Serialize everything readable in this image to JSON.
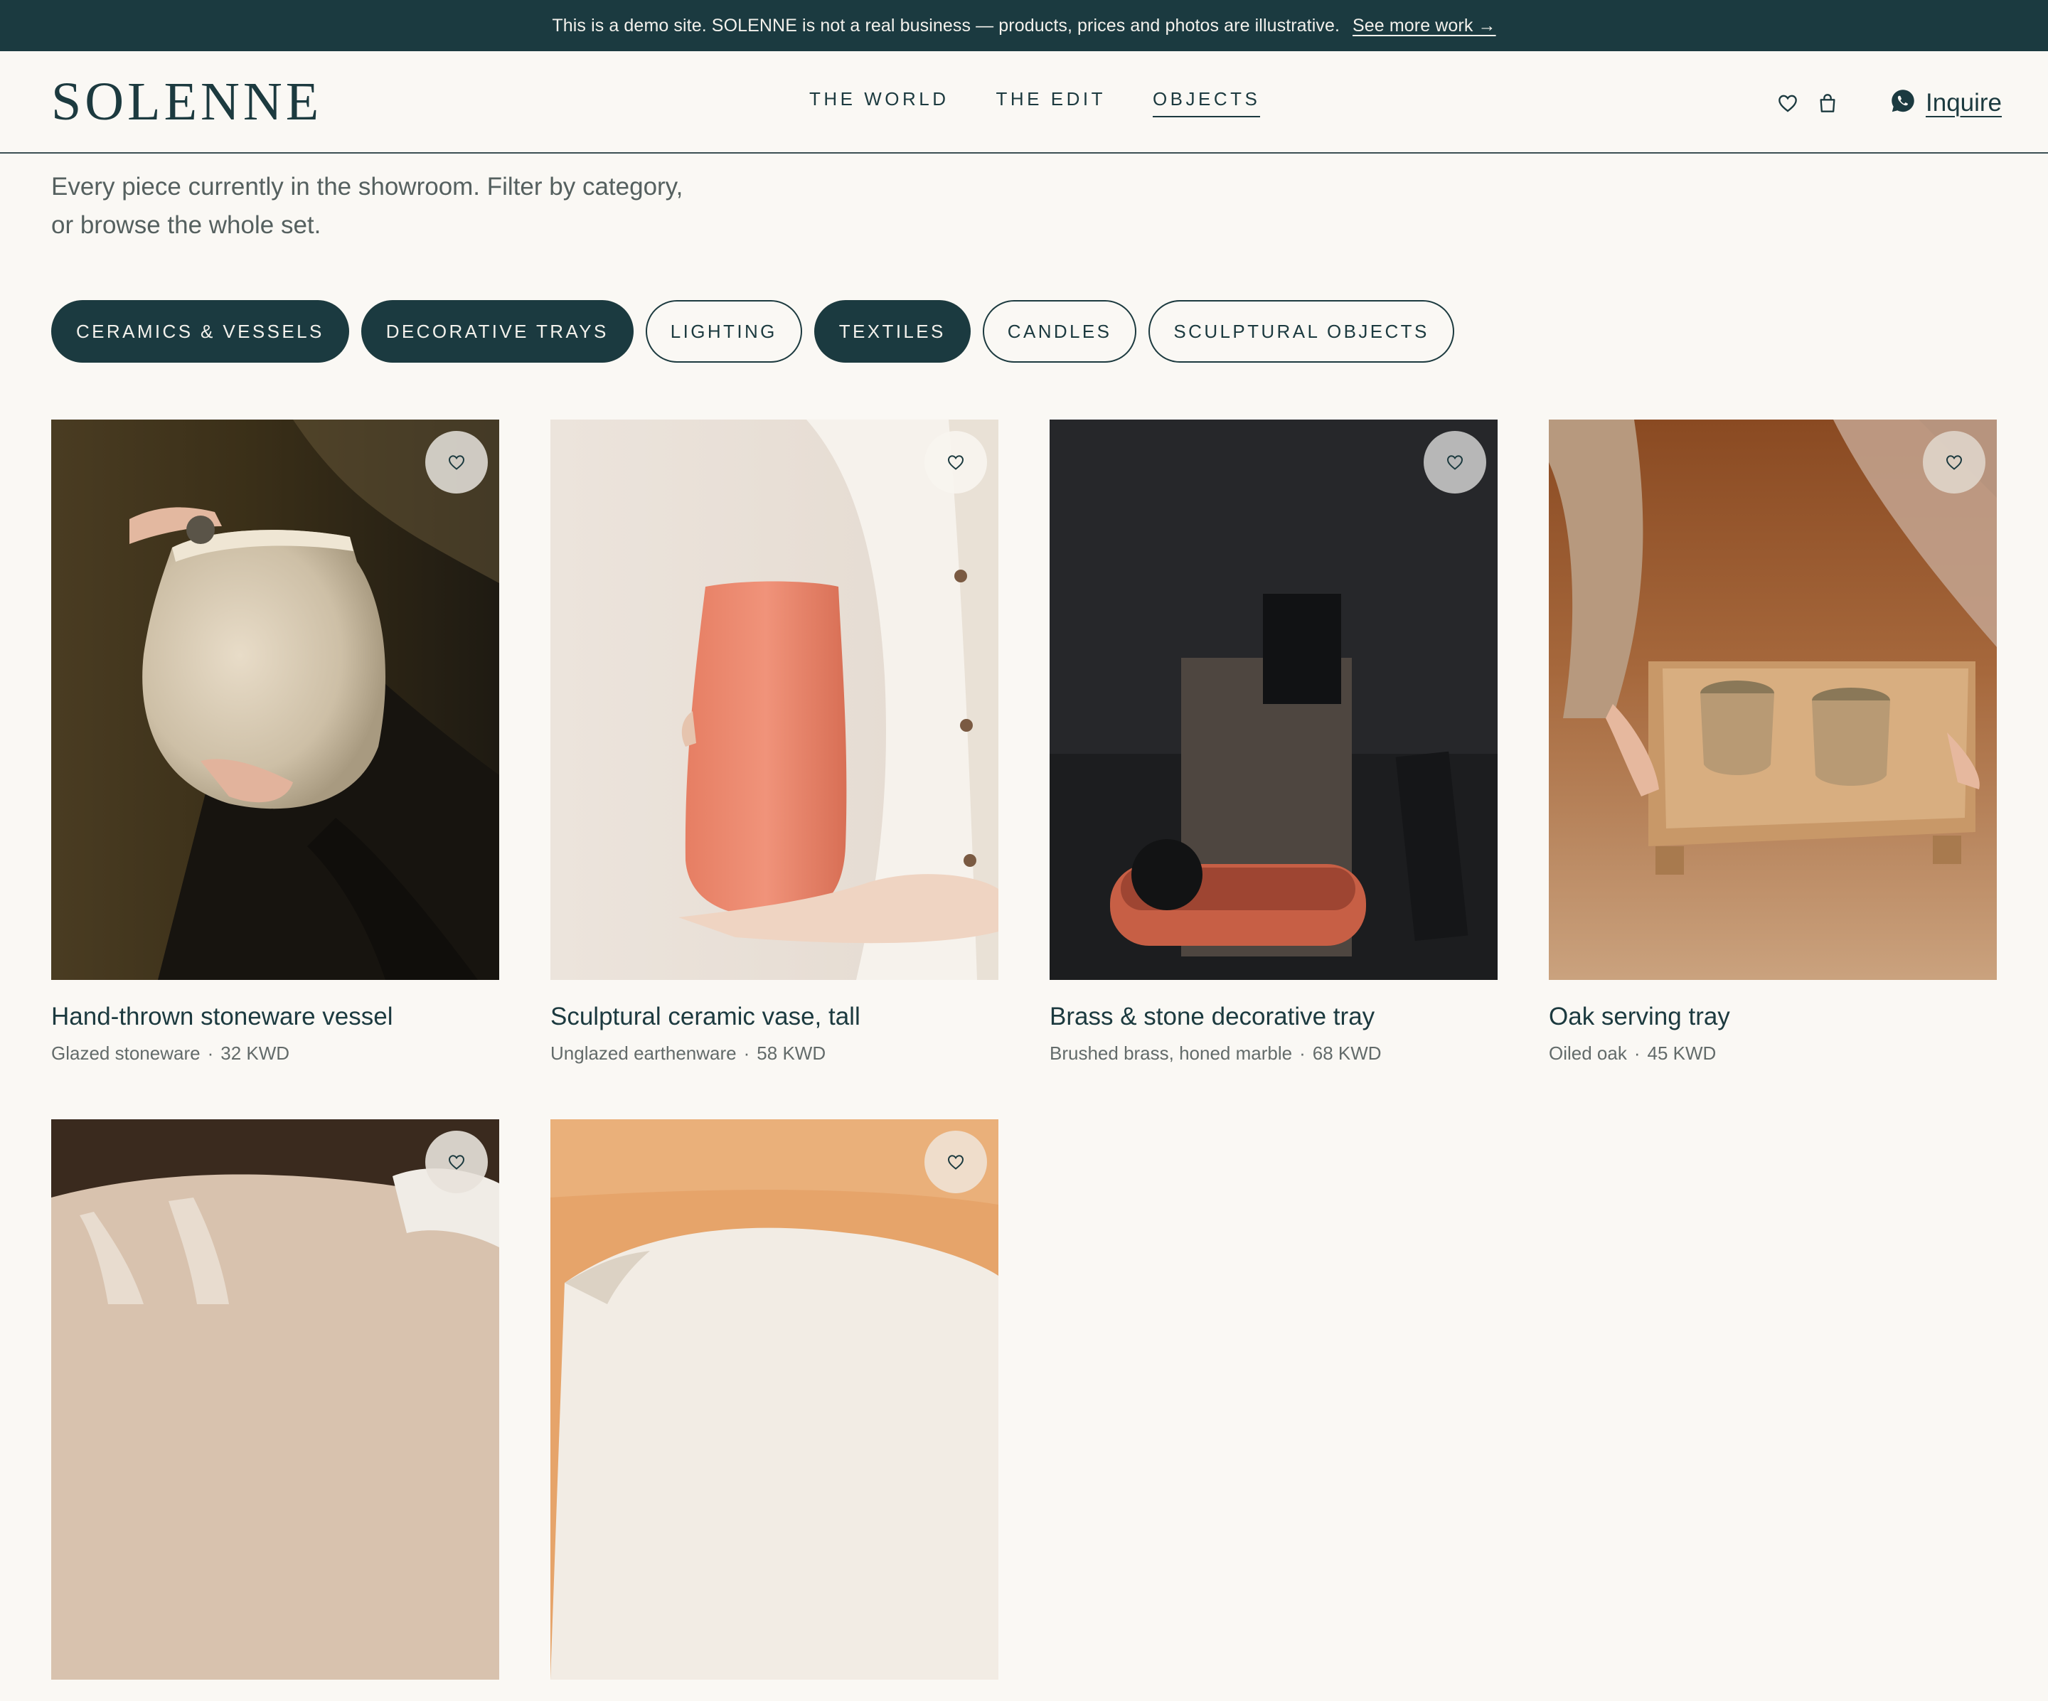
{
  "banner": {
    "text": "This is a demo site. SOLENNE is not a real business — products, prices and photos are illustrative.",
    "link": "See more work →"
  },
  "header": {
    "logo": "SOLENNE",
    "nav": [
      "THE WORLD",
      "THE EDIT",
      "OBJECTS"
    ],
    "active_nav": "OBJECTS",
    "icons": [
      "heart-icon",
      "bag-icon"
    ],
    "inquire_icon": "whatsapp-icon",
    "inquire_label": "Inquire"
  },
  "intro": {
    "line1": "Every piece currently in the showroom. Filter by category,",
    "line2": "or browse the whole set."
  },
  "filters": [
    {
      "label": "CERAMICS & VESSELS",
      "active": true
    },
    {
      "label": "DECORATIVE TRAYS",
      "active": true
    },
    {
      "label": "LIGHTING",
      "active": false
    },
    {
      "label": "TEXTILES",
      "active": true
    },
    {
      "label": "CANDLES",
      "active": false
    },
    {
      "label": "SCULPTURAL OBJECTS",
      "active": false
    }
  ],
  "products": [
    {
      "title": "Hand-thrown stoneware vessel",
      "material": "Glazed stoneware",
      "price": "32 KWD"
    },
    {
      "title": "Sculptural ceramic vase, tall",
      "material": "Unglazed earthenware",
      "price": "58 KWD"
    },
    {
      "title": "Brass & stone decorative tray",
      "material": "Brushed brass, honed marble",
      "price": "68 KWD"
    },
    {
      "title": "Oak serving tray",
      "material": "Oiled oak",
      "price": "45 KWD"
    },
    {
      "title": "",
      "material": "",
      "price": ""
    },
    {
      "title": "",
      "material": "",
      "price": ""
    }
  ],
  "colors": {
    "primary": "#1b3a40",
    "background": "#faf8f4",
    "muted_text": "#636b6a"
  }
}
